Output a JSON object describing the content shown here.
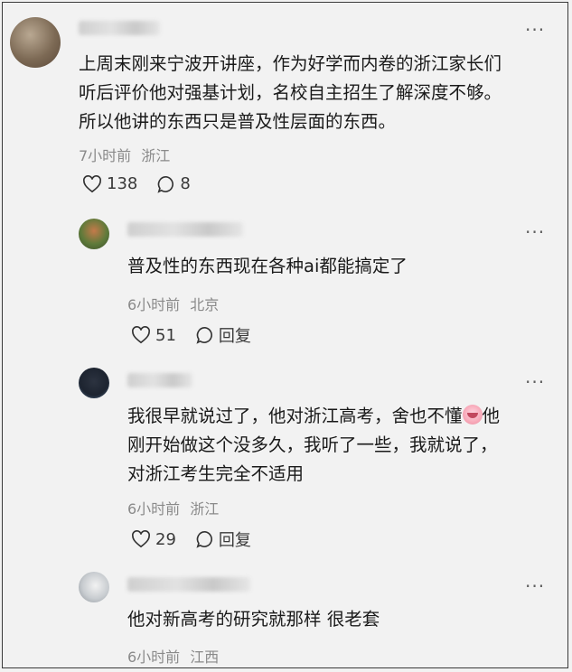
{
  "comments": [
    {
      "text_lines": [
        "上周末刚来宁波开讲座，作为好学而内卷的浙江家长们",
        "听后评价他对强基计划，名校自主招生了解深度不够。",
        "所以他讲的东西只是普及性层面的东西。"
      ],
      "time": "7小时前",
      "location": "浙江",
      "likes": "138",
      "replies": "8",
      "more": "···"
    },
    {
      "text_lines": [
        "普及性的东西现在各种ai都能搞定了"
      ],
      "time": "6小时前",
      "location": "北京",
      "likes": "51",
      "reply_label": "回复",
      "more": "···"
    },
    {
      "text_lines": [
        "我很早就说过了，他对浙江高考，舍也不懂",
        "刚开始做这个没多久，我听了一些，我就说了，",
        "对浙江考生完全不适用"
      ],
      "line1_tail": "他",
      "time": "6小时前",
      "location": "浙江",
      "likes": "29",
      "reply_label": "回复",
      "more": "···"
    },
    {
      "text_lines": [
        "他对新高考的研究就那样 很老套"
      ],
      "time": "6小时前",
      "location": "江西",
      "more": "···"
    }
  ],
  "icons": {
    "like": "heart-outline-icon",
    "comment": "speech-bubble-icon",
    "more": "more-dots-icon"
  }
}
